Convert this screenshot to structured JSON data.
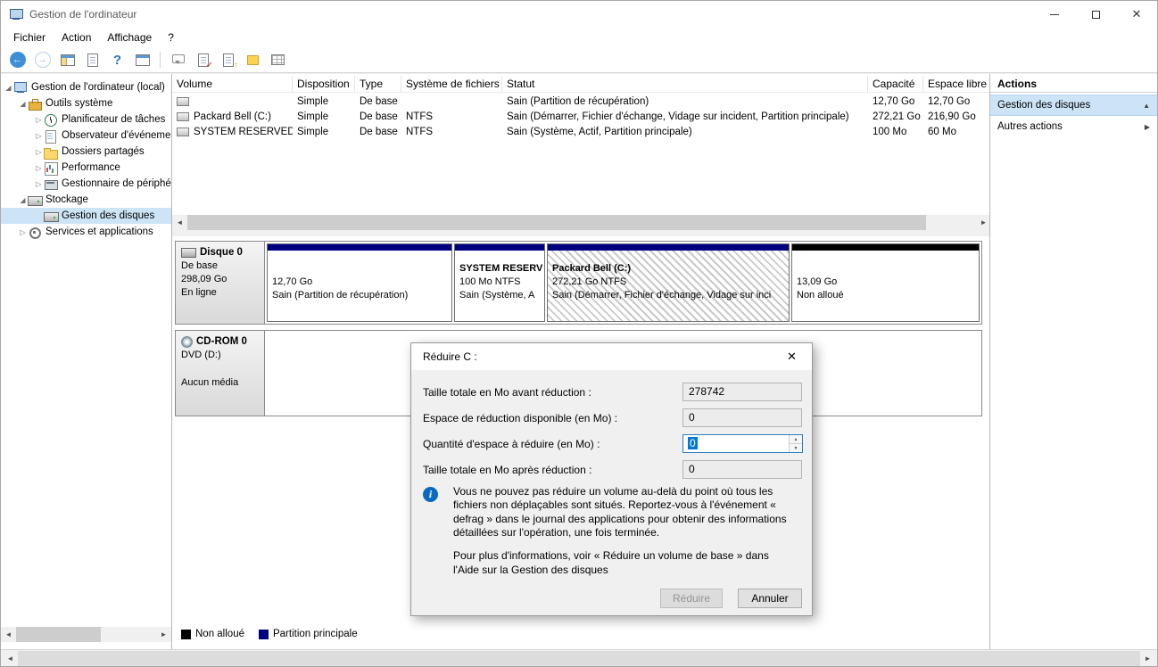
{
  "window": {
    "title": "Gestion de l'ordinateur"
  },
  "menubar": {
    "items": [
      "Fichier",
      "Action",
      "Affichage",
      "?"
    ]
  },
  "icons": {
    "back": "←",
    "forward": "→",
    "help": "?",
    "close": "✕",
    "dialog_close": "✕",
    "expanded": "◢",
    "collapsed": "▷",
    "chevron_up": "▲",
    "chevron_right": "▶",
    "scroll_left": "◄",
    "scroll_right": "►",
    "spin_up": "▲",
    "spin_down": "▼",
    "check": "✓",
    "up_arrow": "↑",
    "info": "i"
  },
  "tree": {
    "items": [
      {
        "label": "Gestion de l'ordinateur (local)"
      },
      {
        "label": "Outils système"
      },
      {
        "label": "Planificateur de tâches"
      },
      {
        "label": "Observateur d'événemen"
      },
      {
        "label": "Dossiers partagés"
      },
      {
        "label": "Performance"
      },
      {
        "label": "Gestionnaire de périphé"
      },
      {
        "label": "Stockage"
      },
      {
        "label": "Gestion des disques"
      },
      {
        "label": "Services et applications"
      }
    ]
  },
  "volume_table": {
    "columns": [
      "Volume",
      "Disposition",
      "Type",
      "Système de fichiers",
      "Statut",
      "Capacité",
      "Espace libre"
    ],
    "rows": [
      {
        "volume": "",
        "disposition": "Simple",
        "type": "De base",
        "filesystem": "",
        "statut": "Sain (Partition de récupération)",
        "capacite": "12,70 Go",
        "espace_libre": "12,70 Go"
      },
      {
        "volume": "Packard Bell (C:)",
        "disposition": "Simple",
        "type": "De base",
        "filesystem": "NTFS",
        "statut": "Sain (Démarrer, Fichier d'échange, Vidage sur incident, Partition principale)",
        "capacite": "272,21 Go",
        "espace_libre": "216,90 Go"
      },
      {
        "volume": "SYSTEM RESERVED",
        "disposition": "Simple",
        "type": "De base",
        "filesystem": "NTFS",
        "statut": "Sain (Système, Actif, Partition principale)",
        "capacite": "100 Mo",
        "espace_libre": "60 Mo"
      }
    ]
  },
  "disk_view": {
    "disk0": {
      "name": "Disque 0",
      "type": "De base",
      "size": "298,09 Go",
      "status": "En ligne",
      "partitions": [
        {
          "name": "",
          "size_line": "12,70 Go",
          "status_line": "Sain (Partition de récupération)"
        },
        {
          "name": "SYSTEM RESERV",
          "size_line": "100 Mo NTFS",
          "status_line": "Sain (Système, A"
        },
        {
          "name": "Packard Bell  (C:)",
          "size_line": "272,21 Go NTFS",
          "status_line": "Sain (Démarrer, Fichier d'échange, Vidage sur inci"
        },
        {
          "name": "",
          "size_line": "13,09 Go",
          "status_line": "Non alloué"
        }
      ]
    },
    "cdrom": {
      "name": "CD-ROM 0",
      "drive": "DVD (D:)",
      "status": "Aucun média"
    }
  },
  "legend": {
    "unallocated": "Non alloué",
    "primary": "Partition principale"
  },
  "actions_panel": {
    "title": "Actions",
    "primary": "Gestion des disques",
    "secondary": "Autres actions"
  },
  "dialog": {
    "title": "Réduire C :",
    "rows": [
      {
        "label": "Taille totale en Mo avant réduction :",
        "value": "278742"
      },
      {
        "label": "Espace de réduction disponible (en Mo) :",
        "value": "0"
      },
      {
        "label": "Quantité d'espace à réduire (en Mo) :",
        "value": "0"
      },
      {
        "label": "Taille totale en Mo après réduction :",
        "value": "0"
      }
    ],
    "info_text": "Vous ne pouvez pas réduire un volume au-delà du point où tous les fichiers non déplaçables sont situés. Reportez-vous à l'événement « defrag » dans le journal des applications pour obtenir des informations détaillées sur l'opération, une fois terminée.",
    "help_text": "Pour plus d'informations, voir « Réduire un volume de base » dans l'Aide sur la Gestion des disques",
    "buttons": {
      "reduce": "Réduire",
      "cancel": "Annuler"
    }
  },
  "colors": {
    "partition_primary": "#000080",
    "unallocated": "#000000",
    "selection": "#0078d7"
  }
}
